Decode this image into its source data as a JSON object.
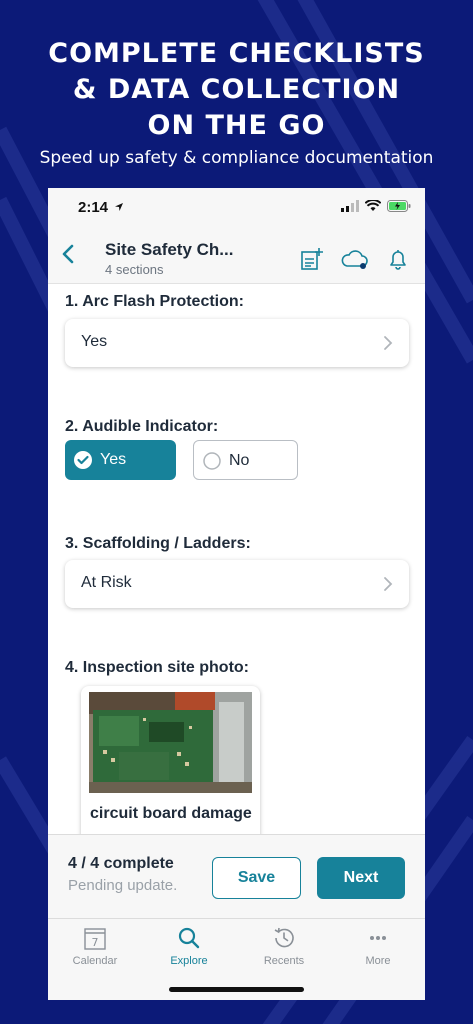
{
  "headline": {
    "line1": "COMPLETE CHECKLISTS",
    "line2": "& DATA COLLECTION",
    "line3": "ON THE GO",
    "subtitle": "Speed up safety & compliance documentation"
  },
  "status_bar": {
    "time": "2:14",
    "icons": [
      "location-arrow-icon",
      "signal-icon",
      "wifi-icon",
      "battery-charging-icon"
    ]
  },
  "nav": {
    "title": "Site Safety Ch...",
    "subtitle": "4 sections",
    "icons": [
      "chevron-left-icon",
      "add-note-icon",
      "cloud-sync-icon",
      "bell-icon"
    ]
  },
  "questions": {
    "q1": {
      "label": "1. Arc Flash Protection:",
      "value": "Yes"
    },
    "q2": {
      "label": "2. Audible Indicator:",
      "options": {
        "yes": "Yes",
        "no": "No"
      },
      "selected": "Yes"
    },
    "q3": {
      "label": "3. Scaffolding / Ladders:",
      "value": "At Risk"
    },
    "q4": {
      "label": "4. Inspection site photo:",
      "photo_caption": "circuit board damage"
    }
  },
  "footer": {
    "progress": "4 / 4 complete",
    "status": "Pending update.",
    "save_label": "Save",
    "next_label": "Next"
  },
  "tabs": [
    {
      "label": "Calendar",
      "icon": "calendar-icon",
      "badge": "7"
    },
    {
      "label": "Explore",
      "icon": "search-icon"
    },
    {
      "label": "Recents",
      "icon": "history-icon"
    },
    {
      "label": "More",
      "icon": "more-icon"
    }
  ],
  "colors": {
    "background": "#0c1a78",
    "accent": "#17829a",
    "text": "#1f2b3a"
  }
}
